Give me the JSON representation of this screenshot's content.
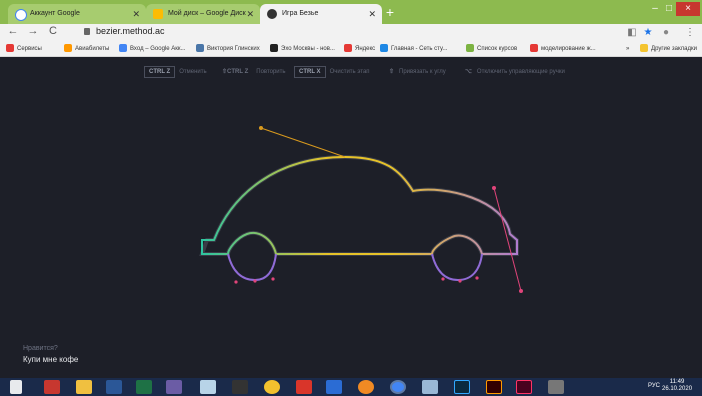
{
  "browser": {
    "tabs": [
      {
        "title": "Аккаунт Google",
        "icon": "google-icon",
        "active": false
      },
      {
        "title": "Мой диск – Google Диск",
        "icon": "google-drive-icon",
        "active": false
      },
      {
        "title": "Игра Безье",
        "icon": "method-icon",
        "active": true
      }
    ],
    "url": "bezier.method.ac",
    "window_controls": [
      "–",
      "□",
      "×"
    ],
    "bookmarks": [
      {
        "label": "Сервисы",
        "icon": "apps-grid-icon",
        "color": "#e53935"
      },
      {
        "label": "Авиабилеты",
        "icon": "aviasales-icon",
        "color": "#ff9800"
      },
      {
        "label": "Вход – Google Акк...",
        "icon": "google-icon",
        "color": "#4285f4"
      },
      {
        "label": "Виктория Глинских",
        "icon": "vk-icon",
        "color": "#4a76a8"
      },
      {
        "label": "Эхо Москвы - нов...",
        "icon": "echo-icon",
        "color": "#222222"
      },
      {
        "label": "Яндекс",
        "icon": "yandex-icon",
        "color": "#e53935"
      },
      {
        "label": "Главная - Сеть сту...",
        "icon": "network-icon",
        "color": "#1e88e5"
      },
      {
        "label": "Список курсов",
        "icon": "leaf-icon",
        "color": "#7cb342"
      },
      {
        "label": "моделирование ж...",
        "icon": "yandex-icon",
        "color": "#e53935"
      }
    ],
    "other_bookmarks": "Другие закладки",
    "overflow": "»"
  },
  "toolbar": {
    "undo_key": "CTRL Z",
    "undo_label": "Отменить",
    "redo_key": "⇧CTRL Z",
    "redo_label": "Повторить",
    "clear_key": "CTRL X",
    "clear_label": "Очистить этап",
    "snap_key": "⇧",
    "snap_label": "Привязать к углу",
    "handles_key": "⌥",
    "handles_label": "Отключить управляющие ручки"
  },
  "promo": {
    "question": "Нравится?",
    "cta": "Купи мне кофе"
  },
  "taskbar": {
    "lang": "РУС",
    "time": "11:49",
    "date": "26.10.2020"
  }
}
